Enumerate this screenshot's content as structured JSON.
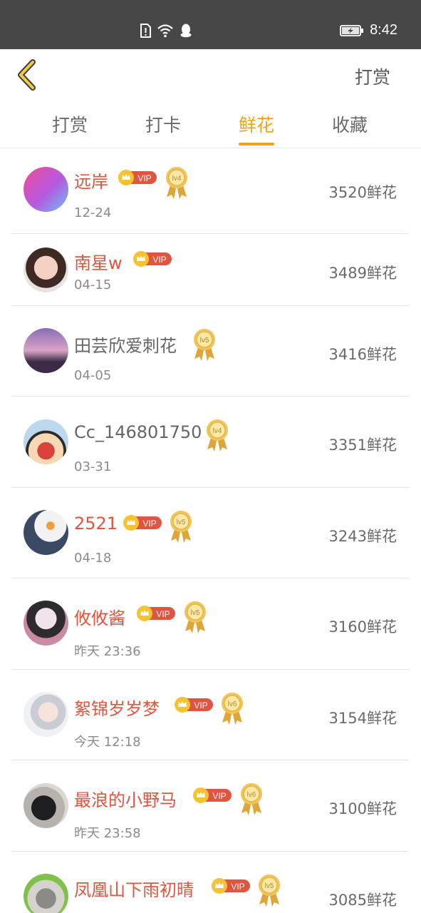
{
  "status_bar": {
    "time": "8:42",
    "icons": [
      "sim-alert-icon",
      "wifi-icon",
      "qq-icon",
      "battery-charging-icon"
    ]
  },
  "header": {
    "back_icon": "chevron-left-icon",
    "action_label": "打赏"
  },
  "tabs": [
    {
      "label": "打赏",
      "active": false
    },
    {
      "label": "打卡",
      "active": false
    },
    {
      "label": "鲜花",
      "active": true
    },
    {
      "label": "收藏",
      "active": false
    }
  ],
  "colors": {
    "accent": "#f5a213",
    "vip_name": "#e0553f",
    "status_bar": "#474747"
  },
  "vip_label": "VIP",
  "list": [
    {
      "name": "远岸",
      "vip": true,
      "level": "lv4",
      "time": "12-24",
      "flowers": "3520鲜花"
    },
    {
      "name": "南星w",
      "vip": true,
      "level": "",
      "time": "04-15",
      "flowers": "3489鲜花"
    },
    {
      "name": "田芸欣爱刺花",
      "vip": false,
      "level": "lv5",
      "time": "04-05",
      "flowers": "3416鲜花"
    },
    {
      "name": "Cc_146801750",
      "vip": false,
      "level": "lv4",
      "time": "03-31",
      "flowers": "3351鲜花"
    },
    {
      "name": "2521",
      "vip": true,
      "level": "lv5",
      "time": "04-18",
      "flowers": "3243鲜花"
    },
    {
      "name": "攸攸酱",
      "vip": true,
      "level": "lv5",
      "time": "昨天 23:36",
      "flowers": "3160鲜花"
    },
    {
      "name": "絮锦岁岁梦",
      "vip": true,
      "level": "lv6",
      "time": "今天 12:18",
      "flowers": "3154鲜花"
    },
    {
      "name": "最浪的小野马",
      "vip": true,
      "level": "lv6",
      "time": "昨天 23:58",
      "flowers": "3100鲜花"
    },
    {
      "name": "凤凰山下雨初晴",
      "vip": true,
      "level": "lv5",
      "time": "",
      "flowers": "3085鲜花"
    }
  ]
}
